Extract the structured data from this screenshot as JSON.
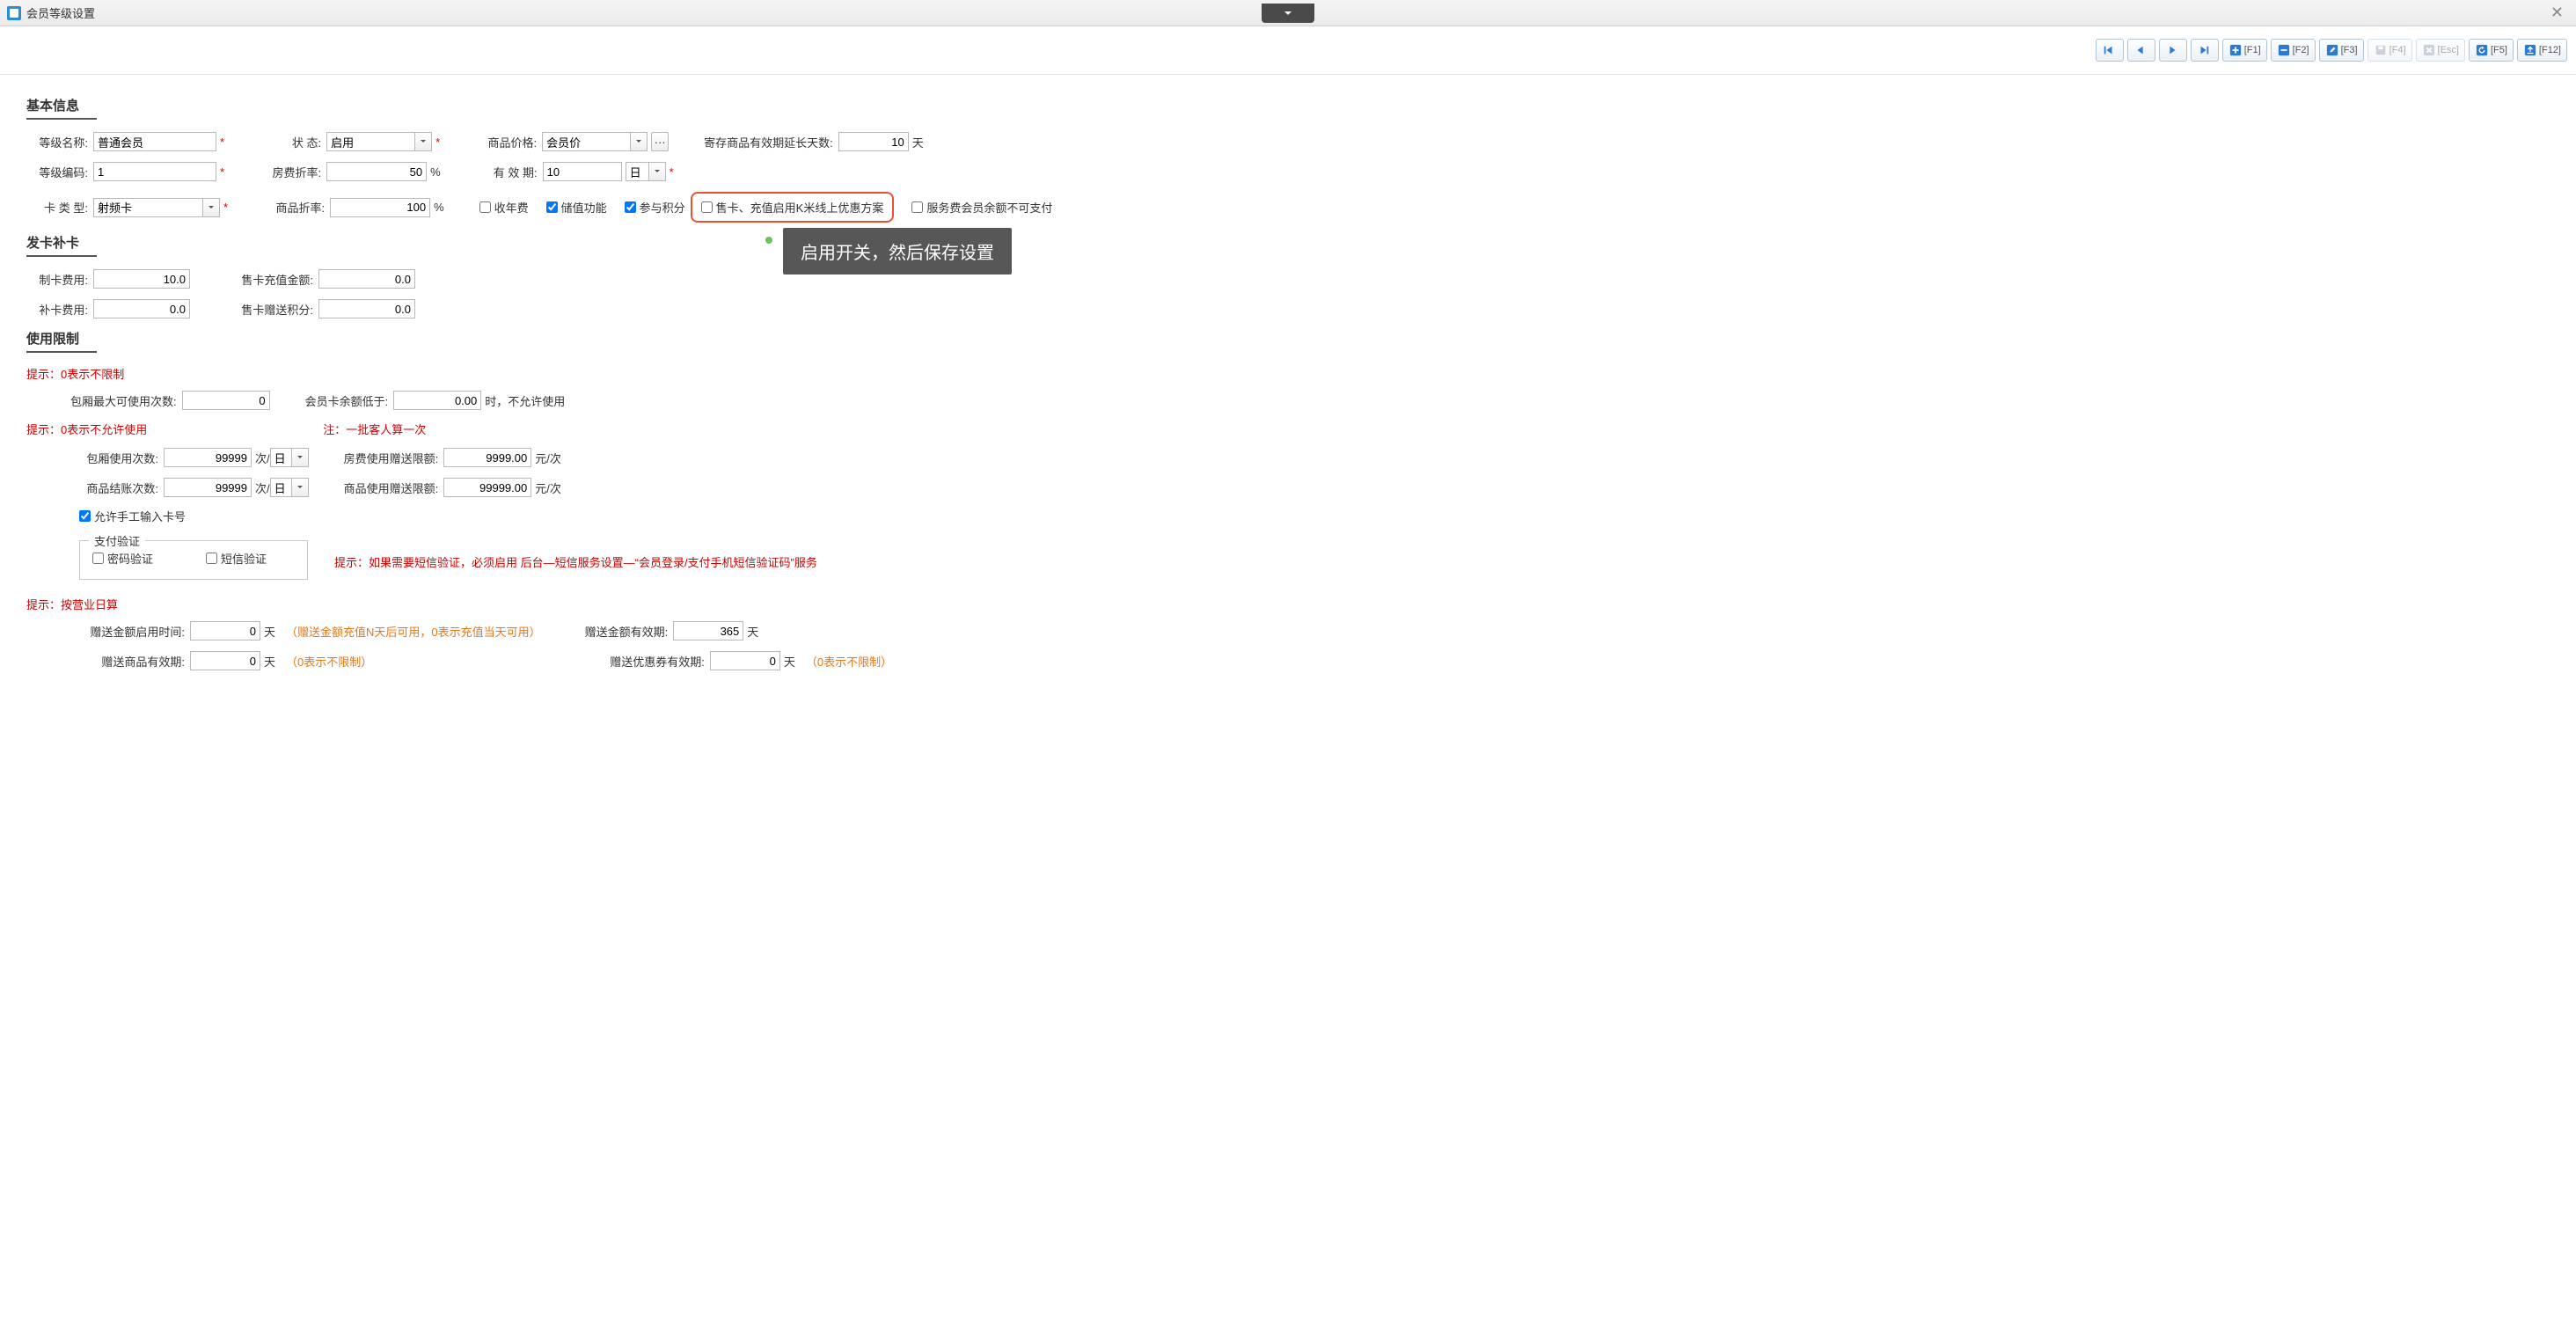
{
  "window": {
    "title": "会员等级设置"
  },
  "toolbar": {
    "f1": "[F1]",
    "f2": "[F2]",
    "f3": "[F3]",
    "f4": "[F4]",
    "esc": "[Esc]",
    "f5": "[F5]",
    "f12": "[F12]"
  },
  "sections": {
    "basic": "基本信息",
    "card": "发卡补卡",
    "limit": "使用限制"
  },
  "basic": {
    "level_name_label": "等级名称:",
    "level_name": "普通会员",
    "status_label": "状   态:",
    "status": "启用",
    "goods_price_label": "商品价格:",
    "goods_price": "会员价",
    "deposit_ext_label": "寄存商品有效期延长天数:",
    "deposit_ext": "10",
    "deposit_ext_unit": "天",
    "level_code_label": "等级编码:",
    "level_code": "1",
    "room_discount_label": "房费折率:",
    "room_discount": "50",
    "percent": "%",
    "valid_label": "有 效 期:",
    "valid": "10",
    "valid_unit": "日",
    "card_type_label": "卡 类 型:",
    "card_type": "射频卡",
    "goods_discount_label": "商品折率:",
    "goods_discount": "100",
    "annual_fee": "收年费",
    "stored_value": "储值功能",
    "points": "参与积分",
    "kmi_promo": "售卡、充值启用K米线上优惠方案",
    "service_fee_restrict": "服务费会员余额不可支付"
  },
  "callout": "启用开关，然后保存设置",
  "card": {
    "make_fee_label": "制卡费用:",
    "make_fee": "10.0",
    "sell_recharge_label": "售卡充值金额:",
    "sell_recharge": "0.0",
    "replace_fee_label": "补卡费用:",
    "replace_fee": "0.0",
    "sell_points_label": "售卡赠送积分:",
    "sell_points": "0.0"
  },
  "limit": {
    "hint1": "提示：0表示不限制",
    "box_max_label": "包厢最大可使用次数:",
    "box_max": "0",
    "balance_low_label": "会员卡余额低于:",
    "balance_low": "0.00",
    "balance_low_suffix": "时，不允许使用",
    "hint2": "提示：0表示不允许使用",
    "note_batch": "注：一批客人算一次",
    "box_use_label": "包厢使用次数:",
    "box_use": "99999",
    "per_day": "次/",
    "day_unit": "日",
    "room_gift_label": "房费使用赠送限额:",
    "room_gift": "9999.00",
    "yuan_per": "元/次",
    "goods_settle_label": "商品结账次数:",
    "goods_settle": "99999",
    "goods_gift_label": "商品使用赠送限额:",
    "goods_gift": "99999.00",
    "manual_card": "允许手工输入卡号",
    "pay_verify_title": "支付验证",
    "pwd_verify": "密码验证",
    "sms_verify": "短信验证",
    "sms_hint": "提示：如果需要短信验证，必须启用 后台—短信服务设置—“会员登录/支付手机短信验证码”服务",
    "hint3": "提示：按营业日算",
    "gift_enable_label": "赠送金额启用时间:",
    "gift_enable": "0",
    "day": "天",
    "gift_enable_note": "（赠送金额充值N天后可用，0表示充值当天可用）",
    "gift_valid_label": "赠送金额有效期:",
    "gift_valid": "365",
    "gift_goods_valid_label": "赠送商品有效期:",
    "gift_goods_valid": "0",
    "zero_unlimited": "（0表示不限制）",
    "coupon_valid_label": "赠送优惠券有效期:",
    "coupon_valid": "0"
  },
  "misc": {
    "ellipsis": "···"
  }
}
